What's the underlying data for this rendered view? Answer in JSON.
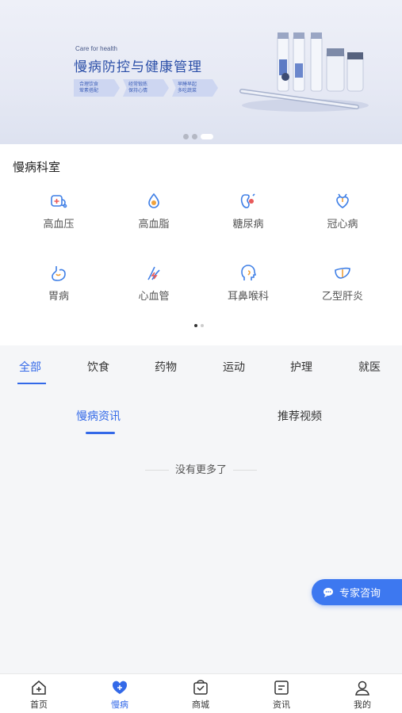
{
  "banner": {
    "subtitle": "Care for health",
    "title": "慢病防控与健康管理",
    "tags": [
      {
        "line1": "合理饮食",
        "line2": "荤素搭配"
      },
      {
        "line1": "经常锻炼",
        "line2": "保持心情"
      },
      {
        "line1": "早睡早起",
        "line2": "多吃蔬菜"
      }
    ],
    "slide_index": 3,
    "slide_count": 3
  },
  "dept": {
    "title": "慢病科室",
    "items": [
      {
        "label": "高血压",
        "icon": "blood-pressure-icon"
      },
      {
        "label": "高血脂",
        "icon": "blood-drop-icon"
      },
      {
        "label": "糖尿病",
        "icon": "kidney-icon"
      },
      {
        "label": "冠心病",
        "icon": "heart-icon"
      },
      {
        "label": "胃病",
        "icon": "stomach-icon"
      },
      {
        "label": "心血管",
        "icon": "vessel-icon"
      },
      {
        "label": "耳鼻喉科",
        "icon": "head-icon"
      },
      {
        "label": "乙型肝炎",
        "icon": "liver-icon"
      }
    ],
    "page_index": 1,
    "page_count": 2
  },
  "categories": [
    "全部",
    "饮食",
    "药物",
    "运动",
    "护理",
    "就医"
  ],
  "active_category": "全部",
  "sub_tabs": [
    "慢病资讯",
    "推荐视频"
  ],
  "active_sub_tab": "慢病资讯",
  "empty_text": "没有更多了",
  "consult_button": "专家咨询",
  "nav": {
    "items": [
      {
        "label": "首页",
        "icon": "home-icon"
      },
      {
        "label": "慢病",
        "icon": "heart-plus-icon"
      },
      {
        "label": "商城",
        "icon": "shopping-bag-icon"
      },
      {
        "label": "资讯",
        "icon": "news-icon"
      },
      {
        "label": "我的",
        "icon": "user-icon"
      }
    ],
    "active": "慢病"
  },
  "colors": {
    "accent": "#3369e8",
    "banner_title": "#2b4fa8",
    "consult_bg": "#3d78f0"
  }
}
